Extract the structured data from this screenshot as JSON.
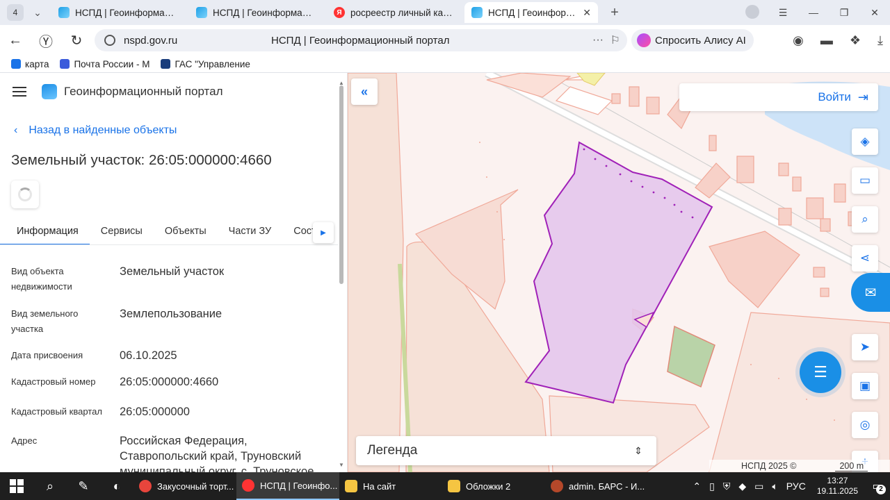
{
  "browser": {
    "tab_count": "4",
    "tabs": [
      {
        "label": "НСПД | Геоинформацион",
        "favicon": "nspd"
      },
      {
        "label": "НСПД | Геоинформацион",
        "favicon": "nspd"
      },
      {
        "label": "росреестр личный кабин",
        "favicon": "yandex"
      },
      {
        "label": "НСПД | Геоинформаци",
        "favicon": "nspd",
        "active": true
      }
    ],
    "url_host": "nspd.gov.ru",
    "page_title": "НСПД | Геоинформационный портал",
    "alice_label": "Спросить Алису AI",
    "bookmarks": [
      {
        "label": "карта",
        "color": "#1a73e8"
      },
      {
        "label": "Почта России - М",
        "color": "#3b5bdb"
      },
      {
        "label": "ГАС \"Управление",
        "color": "#1a3d7c"
      }
    ]
  },
  "panel": {
    "portal_name": "Геоинформационный портал",
    "back_label": "Назад в найденные объекты",
    "object_title": "Земельный участок: 26:05:000000:4660",
    "tabs": [
      "Информация",
      "Сервисы",
      "Объекты",
      "Части ЗУ",
      "Соста"
    ],
    "info": [
      {
        "label": "Вид объекта недвижимости",
        "value": "Земельный участок"
      },
      {
        "label": "Вид земельного участка",
        "value": "Землепользование"
      },
      {
        "label": "Дата присвоения",
        "value": "06.10.2025"
      },
      {
        "label": "Кадастровый номер",
        "value": "26:05:000000:4660"
      },
      {
        "label": "Кадастровый квартал",
        "value": "26:05:000000"
      },
      {
        "label": "Адрес",
        "value": "Российская Федерация, Ставропольский край, Труновский муниципальный округ, с. Труновское"
      }
    ]
  },
  "map": {
    "login_label": "Войти",
    "legend_label": "Легенда",
    "copyright": "НСПД 2025 ©",
    "scale_label": "200 m",
    "colors": {
      "parcel_fill": "#e3c4ec",
      "parcel_stroke": "#a021b8",
      "green_fill": "#b9d3a8",
      "salmon": "#f0a898",
      "accent": "#1a73e8"
    }
  },
  "taskbar": {
    "apps": [
      {
        "label": "Закусочный торт...",
        "color": "#e8453c"
      },
      {
        "label": "НСПД | Геоинфо...",
        "color": "#f33",
        "active": true
      },
      {
        "label": "На сайт",
        "color": "#f5c542"
      },
      {
        "label": "Обложки 2",
        "color": "#f5c542"
      },
      {
        "label": "admin. БАРС - И...",
        "color": "#b5482a"
      }
    ],
    "language": "РУС",
    "time": "13:27",
    "date": "19.11.2025",
    "notifications": "2"
  }
}
